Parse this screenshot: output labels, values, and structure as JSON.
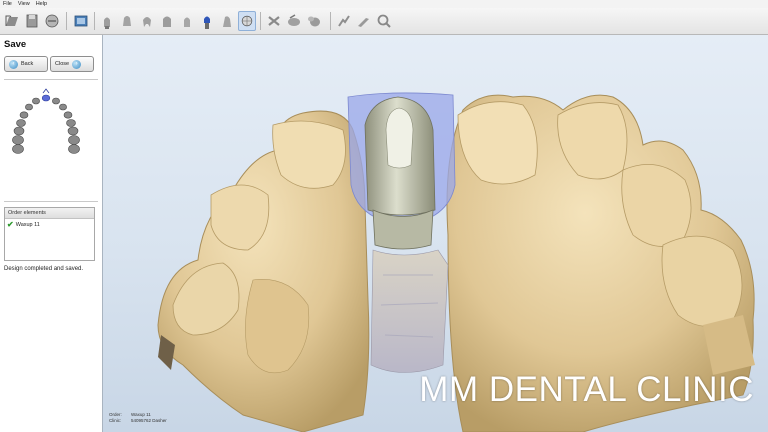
{
  "menu": [
    "File",
    "View",
    "Help"
  ],
  "toolbar": {
    "icons": [
      "open-icon",
      "save-file-icon",
      "scan-icon",
      "render-icon",
      "tooth-icon-1",
      "tooth-icon-2",
      "tooth-icon-3",
      "tooth-icon-4",
      "tooth-icon-5",
      "tooth-icon-6",
      "implant-icon",
      "tooth-icon-7",
      "view-3d-icon",
      "sculpt-icon",
      "smooth-icon",
      "morph-icon",
      "wax-icon",
      "knife-icon",
      "zoom-icon"
    ],
    "active": "view-3d-icon"
  },
  "panel": {
    "step_title": "Save",
    "back_label": "Back",
    "close_label": "Close",
    "order_header": "Order elements",
    "order_item": "Waxup 11",
    "status": "Design completed and saved."
  },
  "viewport": {
    "order_label": "Order:",
    "order_value": "Waxup 11",
    "clinic_label": "Clinic:",
    "clinic_value": "54095762 Dasher",
    "watermark": "MM DENTAL CLINIC"
  },
  "colors": {
    "tooth": "#e8d3a6",
    "tooth_shadow": "#b39a67",
    "implant": "#c9cbb8",
    "waxup_overlay": "#9aa7ea",
    "viewport_bg": "#dce6f1",
    "check": "#2e9a2e"
  }
}
